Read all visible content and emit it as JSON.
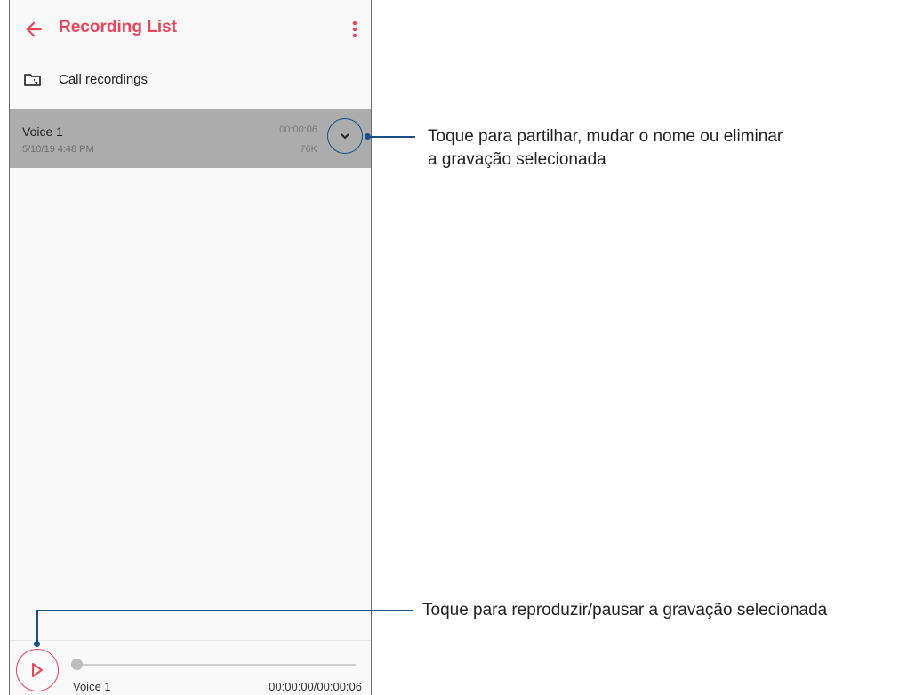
{
  "colors": {
    "accent": "#e8445a",
    "callout": "#1a4f8a",
    "selected_row": "#acacac"
  },
  "appbar": {
    "title": "Recording List",
    "back_icon": "arrow-left-icon",
    "menu_icon": "more-vertical-icon"
  },
  "folder": {
    "label": "Call recordings",
    "icon": "folder-call-icon"
  },
  "recordings": [
    {
      "name": "Voice 1",
      "date": "5/10/19 4:48 PM",
      "duration": "00:00:06",
      "size": "76K",
      "selected": true
    }
  ],
  "player": {
    "name": "Voice 1",
    "time": "00:00:00/00:00:06",
    "progress": 0,
    "play_icon": "play-icon"
  },
  "callouts": {
    "expand": {
      "line1": "Toque para partilhar, mudar o nome ou eliminar",
      "line2": "a gravação selecionada"
    },
    "play": {
      "text": "Toque para reproduzir/pausar a gravação selecionada"
    }
  }
}
